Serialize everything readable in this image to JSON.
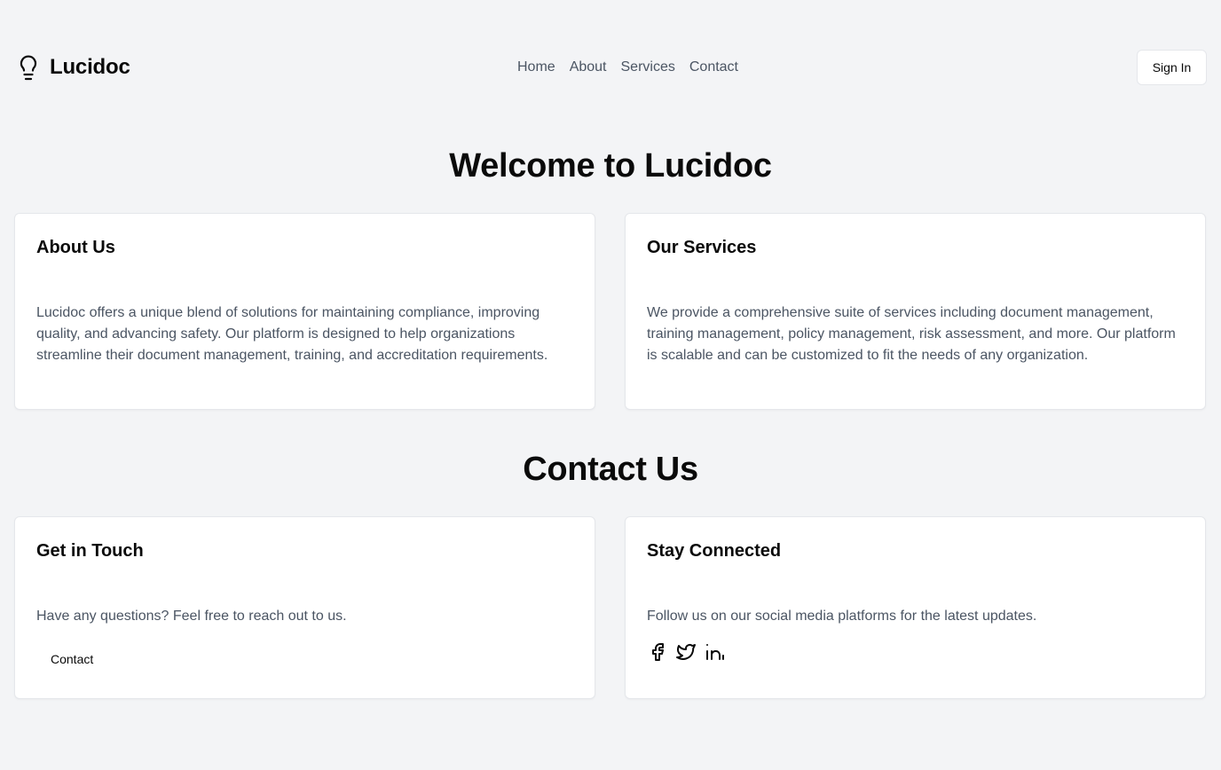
{
  "header": {
    "brand_name": "Lucidoc",
    "logo_icon": "lightbulb-icon",
    "nav": [
      "Home",
      "About",
      "Services",
      "Contact"
    ],
    "sign_in_label": "Sign In"
  },
  "welcome": {
    "title": "Welcome to Lucidoc",
    "about": {
      "title": "About Us",
      "text": "Lucidoc offers a unique blend of solutions for maintaining compliance, improving quality, and advancing safety. Our platform is designed to help organizations streamline their document management, training, and accreditation requirements."
    },
    "services": {
      "title": "Our Services",
      "text": "We provide a comprehensive suite of services including document management, training management, policy management, risk assessment, and more. Our platform is scalable and can be customized to fit the needs of any organization."
    }
  },
  "contact": {
    "title": "Contact Us",
    "get_in_touch": {
      "title": "Get in Touch",
      "text": "Have any questions? Feel free to reach out to us.",
      "button_label": "Contact"
    },
    "stay_connected": {
      "title": "Stay Connected",
      "text": "Follow us on our social media platforms for the latest updates.",
      "icons": [
        "facebook-icon",
        "twitter-icon",
        "linkedin-icon"
      ]
    }
  },
  "colors": {
    "background": "#f3f4f6",
    "card": "#ffffff",
    "text_primary": "#0a0a0a",
    "text_muted": "#4b5563",
    "border": "#e5e7eb"
  }
}
